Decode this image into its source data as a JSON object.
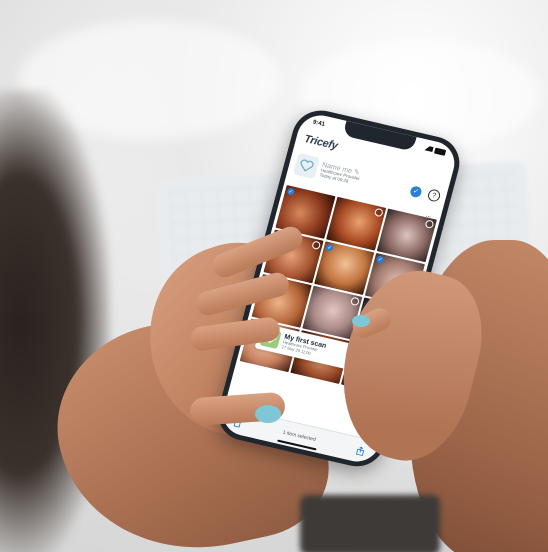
{
  "status_bar": {
    "time": "9:41"
  },
  "app": {
    "logo": "Tricefy"
  },
  "album": {
    "name": "Name me",
    "provider": "Healthcare Provider",
    "date": "Today at 09:28"
  },
  "more_menu": "···",
  "scan_card": {
    "title": "My first scan",
    "provider": "Healthcare Provider",
    "date": "27 May 20 11:00"
  },
  "bottom_bar": {
    "selection_text": "1 item selected"
  },
  "icons": {
    "check": "✓",
    "help": "?",
    "pencil": "✎",
    "trash": "🗑",
    "share": "⇧"
  }
}
